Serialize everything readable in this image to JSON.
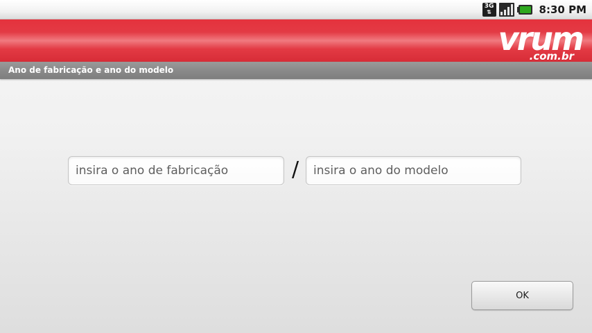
{
  "status_bar": {
    "network_type": "3G",
    "network_icon": "3g-data-icon",
    "signal_icon": "signal-strength-icon",
    "battery_icon": "battery-icon",
    "battery_color": "#2ea81e",
    "time": "8:30 PM"
  },
  "header": {
    "brand_name": "vrum",
    "brand_suffix": ".com.br",
    "brand_color": "#e3323d"
  },
  "title_bar": {
    "title": "Ano de fabricação e ano do modelo"
  },
  "form": {
    "manufacture_year": {
      "value": "",
      "placeholder": "insira o ano de fabricação"
    },
    "separator": "/",
    "model_year": {
      "value": "",
      "placeholder": "insira o ano do modelo"
    },
    "ok_label": "OK"
  }
}
